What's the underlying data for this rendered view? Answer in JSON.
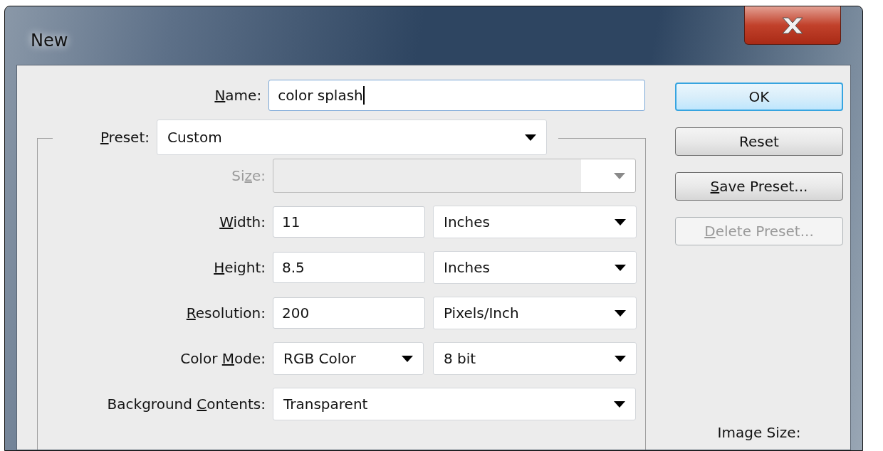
{
  "window": {
    "title": "New"
  },
  "name_field": {
    "label": {
      "key": "N",
      "post": "ame:"
    },
    "value": "color splash",
    "focused": true
  },
  "preset": {
    "label": {
      "key": "P",
      "post": "reset:"
    },
    "value": "Custom"
  },
  "fields": [
    {
      "kind": "combo",
      "label": {
        "pre": "Si",
        "key": "z",
        "post": "e:"
      },
      "disabled": true
    },
    {
      "kind": "input_unit",
      "label": {
        "key": "W",
        "post": "idth:"
      },
      "value": "11",
      "unit": "Inches",
      "disabled": false
    },
    {
      "kind": "input_unit",
      "label": {
        "key": "H",
        "post": "eight:"
      },
      "value": "8.5",
      "unit": "Inches",
      "disabled": false
    },
    {
      "kind": "input_unit",
      "label": {
        "key": "R",
        "post": "esolution:"
      },
      "value": "200",
      "unit": "Pixels/Inch",
      "disabled": false
    },
    {
      "kind": "dropdown_pair",
      "label": {
        "pre": "Color ",
        "key": "M",
        "post": "ode:"
      },
      "value": "RGB Color",
      "unit": "8 bit",
      "disabled": false
    },
    {
      "kind": "dropdown",
      "label": {
        "pre": "Background ",
        "key": "C",
        "post": "ontents:"
      },
      "value": "Transparent",
      "disabled": false
    }
  ],
  "buttons": [
    {
      "label": {
        "post": "OK"
      },
      "default": true,
      "disabled": false
    },
    {
      "label": {
        "post": "Reset"
      },
      "default": false,
      "disabled": false
    },
    {
      "label": {
        "key": "S",
        "post": "ave Preset..."
      },
      "default": false,
      "disabled": false
    },
    {
      "label": {
        "key": "D",
        "post": "elete Preset..."
      },
      "default": false,
      "disabled": true
    }
  ],
  "image_size": {
    "label": "Image Size:"
  }
}
